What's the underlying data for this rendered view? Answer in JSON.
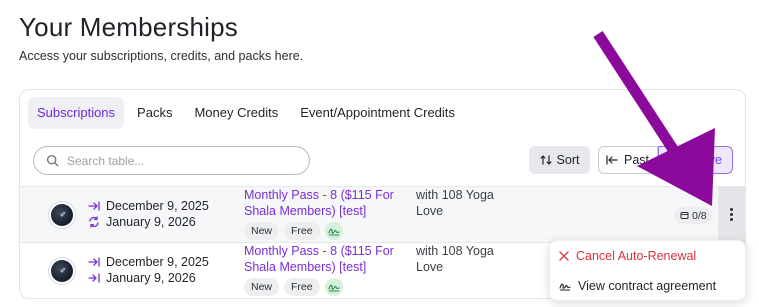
{
  "header": {
    "title": "Your Memberships",
    "subtitle": "Access your subscriptions, credits, and packs here."
  },
  "tabs": [
    {
      "label": "Subscriptions",
      "active": true
    },
    {
      "label": "Packs",
      "active": false
    },
    {
      "label": "Money Credits",
      "active": false
    },
    {
      "label": "Event/Appointment Credits",
      "active": false
    }
  ],
  "toolbar": {
    "search_placeholder": "Search table...",
    "sort_label": "Sort",
    "past_label": "Past",
    "active_label": "Active"
  },
  "rows": [
    {
      "start_date": "December 9, 2025",
      "renew_date": "January 9, 2026",
      "plan_name": "Monthly Pass - 8 ($115 For Shala Members) [test]",
      "badges": [
        "New",
        "Free"
      ],
      "with_label": "with 108 Yoga Love",
      "usage": "0/8"
    },
    {
      "start_date": "December 9, 2025",
      "end_date": "January 9, 2026",
      "plan_name": "Monthly Pass - 8 ($115 For Shala Members) [test]",
      "badges": [
        "New",
        "Free"
      ],
      "with_label": "with 108 Yoga Love"
    }
  ],
  "menu": {
    "cancel_label": "Cancel Auto-Renewal",
    "contract_label": "View contract agreement"
  },
  "colors": {
    "accent": "#7a2fd6",
    "danger": "#d9333f",
    "annotation_arrow": "#8b0a9c"
  }
}
